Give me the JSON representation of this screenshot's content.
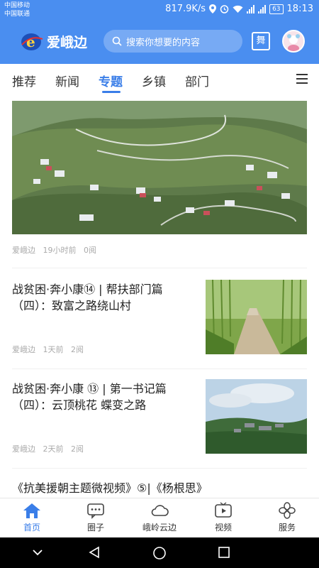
{
  "status_bar": {
    "carrier_1": "中国移动",
    "carrier_2": "中国联通",
    "speed": "817.9K/s",
    "battery": "63",
    "time": "18:13"
  },
  "header": {
    "brand": "爱峨边",
    "search_placeholder": "搜索你想要的内容",
    "calendar_icon_text": "舞"
  },
  "tabs": [
    {
      "label": "推荐"
    },
    {
      "label": "新闻"
    },
    {
      "label": "专题",
      "active": true
    },
    {
      "label": "乡镇"
    },
    {
      "label": "部门"
    }
  ],
  "feed": {
    "hero": {
      "source": "爱峨边",
      "time": "19小时前",
      "reads": "0阅"
    },
    "articles": [
      {
        "title": "战贫困·奔小康⑭ | 帮扶部门篇（四）：致富之路绕山村",
        "source": "爱峨边",
        "time": "1天前",
        "reads": "2阅"
      },
      {
        "title": "战贫困·奔小康 ⑬ | 第一书记篇（四）：云顶桃花 蝶变之路",
        "source": "爱峨边",
        "time": "2天前",
        "reads": "2阅"
      },
      {
        "title": "《抗美援朝主题微视频》⑤|《杨根思》"
      }
    ]
  },
  "bottom_nav": [
    {
      "label": "首页",
      "icon": "home-icon",
      "active": true
    },
    {
      "label": "圈子",
      "icon": "chat-icon"
    },
    {
      "label": "峨岭云边",
      "icon": "cloud-icon"
    },
    {
      "label": "视频",
      "icon": "video-icon"
    },
    {
      "label": "服务",
      "icon": "clover-icon"
    }
  ],
  "colors": {
    "brand_blue": "#4a8ef0",
    "active_blue": "#3a7ee8"
  }
}
